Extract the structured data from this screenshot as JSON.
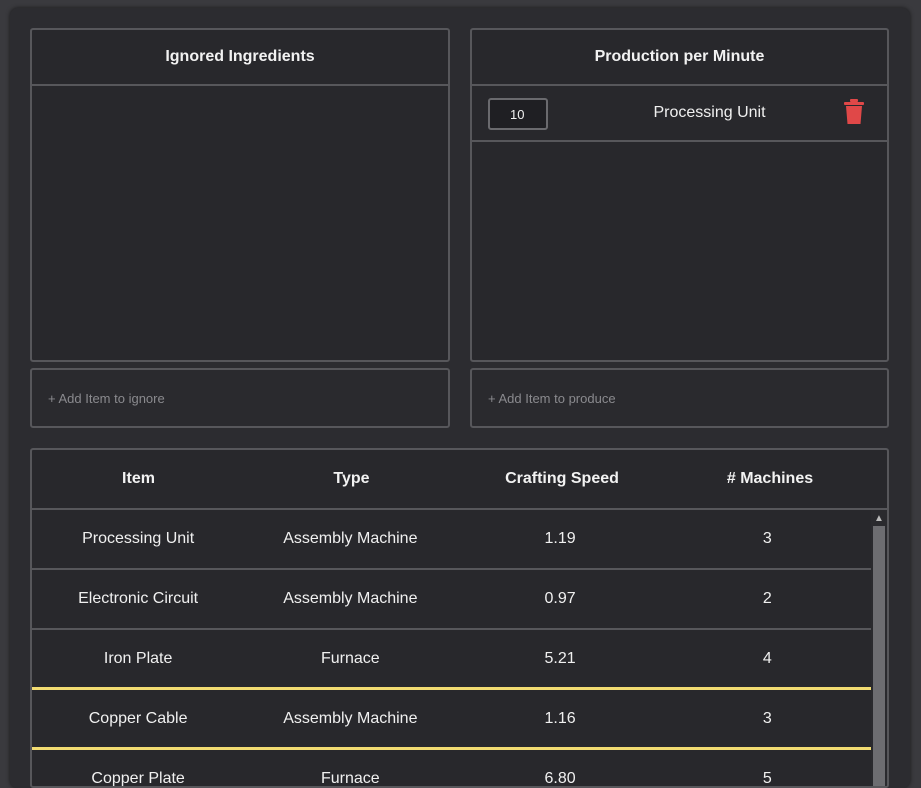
{
  "ignored": {
    "title": "Ignored Ingredients",
    "add_placeholder": "+ Add Item to ignore"
  },
  "production": {
    "title": "Production per Minute",
    "items": [
      {
        "quantity": "10",
        "name": "Processing Unit"
      }
    ],
    "add_placeholder": "+ Add Item to produce"
  },
  "table": {
    "headers": [
      "Item",
      "Type",
      "Crafting Speed",
      "# Machines"
    ],
    "rows": [
      {
        "item": "Processing Unit",
        "type": "Assembly Machine",
        "speed": "1.19",
        "machines": "3"
      },
      {
        "item": "Electronic Circuit",
        "type": "Assembly Machine",
        "speed": "0.97",
        "machines": "2"
      },
      {
        "item": "Iron Plate",
        "type": "Furnace",
        "speed": "5.21",
        "machines": "4"
      },
      {
        "item": "Copper Cable",
        "type": "Assembly Machine",
        "speed": "1.16",
        "machines": "3"
      },
      {
        "item": "Copper Plate",
        "type": "Furnace",
        "speed": "6.80",
        "machines": "5"
      }
    ],
    "highlighted_rows": [
      3
    ]
  },
  "colors": {
    "highlight": "#f2dc72",
    "delete_icon": "#e04848"
  },
  "icons": {
    "delete": "trash-icon",
    "scroll_up": "chevron-up-icon"
  }
}
